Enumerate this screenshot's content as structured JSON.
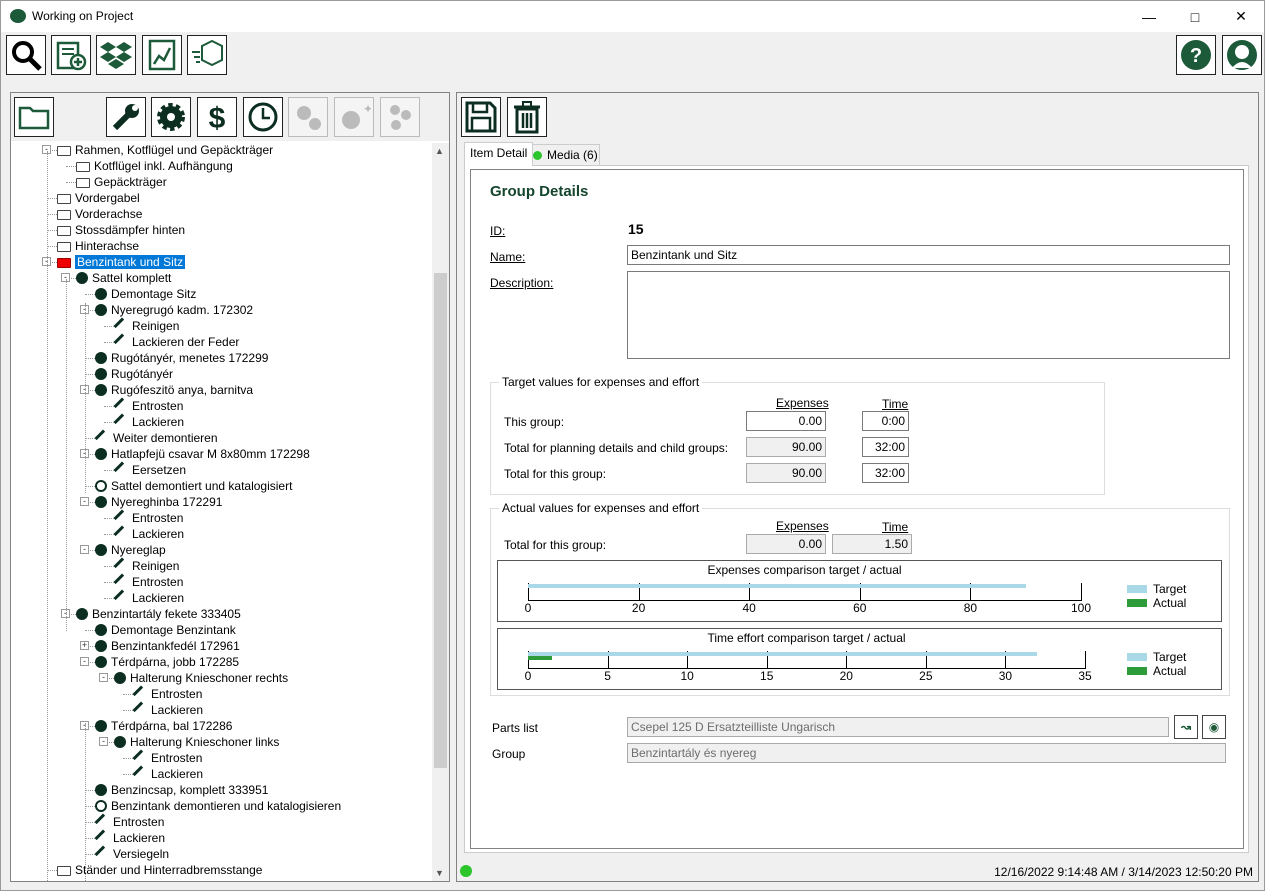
{
  "window": {
    "title": "Working on Project"
  },
  "toolbar": {
    "icons": [
      "search-icon",
      "new-document-icon",
      "dropbox-icon",
      "report-chart-icon",
      "package-icon",
      "help-icon",
      "support-icon"
    ]
  },
  "left_toolbar": {
    "icons": [
      "folder-icon",
      "wrench-icon",
      "gear-icon",
      "dollar-icon",
      "clock-icon",
      "gears-disabled-icon",
      "sparkle-gear-disabled-icon",
      "multi-gear-disabled-icon"
    ]
  },
  "tree": [
    {
      "label": "Rahmen, Kotflügel und Gepäckträger",
      "type": "folder"
    },
    {
      "label": "Kotflügel inkl. Aufhängung",
      "type": "folder"
    },
    {
      "label": "Gepäckträger",
      "type": "folder"
    },
    {
      "label": "Vordergabel",
      "type": "folder"
    },
    {
      "label": "Vorderachse",
      "type": "folder"
    },
    {
      "label": "Stossdämpfer hinten",
      "type": "folder"
    },
    {
      "label": "Hinterachse",
      "type": "folder"
    },
    {
      "label": "Benzintank und Sitz",
      "type": "folder-red",
      "selected": true
    },
    {
      "label": "Sattel komplett",
      "type": "gear"
    },
    {
      "label": "Demontage Sitz",
      "type": "gears"
    },
    {
      "label": "Nyeregrugó kadm. 172302",
      "type": "gear"
    },
    {
      "label": "Reinigen",
      "type": "wrench"
    },
    {
      "label": "Lackieren der Feder",
      "type": "wrench"
    },
    {
      "label": "Rugótányér, menetes 172299",
      "type": "gear"
    },
    {
      "label": "Rugótányér",
      "type": "gear"
    },
    {
      "label": "Rugófeszitö anya, barnitva",
      "type": "gear"
    },
    {
      "label": "Entrosten",
      "type": "wrench"
    },
    {
      "label": "Lackieren",
      "type": "wrench"
    },
    {
      "label": "Weiter demontieren",
      "type": "wrench"
    },
    {
      "label": "Hatlapfejü csavar M 8x80mm 172298",
      "type": "gear"
    },
    {
      "label": "Eersetzen",
      "type": "wrench"
    },
    {
      "label": "Sattel demontiert und katalogisiert",
      "type": "clock"
    },
    {
      "label": "Nyereghinba 172291",
      "type": "gear"
    },
    {
      "label": "Entrosten",
      "type": "wrench"
    },
    {
      "label": "Lackieren",
      "type": "wrench"
    },
    {
      "label": "Nyereglap",
      "type": "gear"
    },
    {
      "label": "Reinigen",
      "type": "wrench"
    },
    {
      "label": "Entrosten",
      "type": "wrench"
    },
    {
      "label": "Lackieren",
      "type": "wrench"
    },
    {
      "label": "Benzintartály fekete 333405",
      "type": "gear"
    },
    {
      "label": "Demontage Benzintank",
      "type": "gears"
    },
    {
      "label": "Benzintankfedél 172961",
      "type": "gear"
    },
    {
      "label": "Térdpárna, jobb 172285",
      "type": "gear"
    },
    {
      "label": "Halterung Knieschoner rechts",
      "type": "gear"
    },
    {
      "label": "Entrosten",
      "type": "wrench"
    },
    {
      "label": "Lackieren",
      "type": "wrench"
    },
    {
      "label": "Térdpárna, bal 172286",
      "type": "gear"
    },
    {
      "label": "Halterung Knieschoner links",
      "type": "gear"
    },
    {
      "label": "Entrosten",
      "type": "wrench"
    },
    {
      "label": "Lackieren",
      "type": "wrench"
    },
    {
      "label": "Benzincsap, komplett 333951",
      "type": "gear"
    },
    {
      "label": "Benzintank demontieren und katalogisieren",
      "type": "clock"
    },
    {
      "label": "Entrosten",
      "type": "wrench"
    },
    {
      "label": "Lackieren",
      "type": "wrench"
    },
    {
      "label": "Versiegeln",
      "type": "wrench"
    },
    {
      "label": "Ständer und Hinterradbremsstange",
      "type": "folder"
    }
  ],
  "right_toolbar": {
    "icons": [
      "save-icon",
      "delete-icon"
    ]
  },
  "tabs": [
    {
      "label": "Item Detail"
    },
    {
      "label": "Media (6)"
    }
  ],
  "details": {
    "heading": "Group Details",
    "id_label": "ID:",
    "id_value": "15",
    "name_label": "Name:",
    "name_value": "Benzintank und Sitz",
    "desc_label": "Description:",
    "desc_value": ""
  },
  "target": {
    "legend": "Target values for expenses and effort",
    "col_expenses": "Expenses",
    "col_time": "Time",
    "rows": [
      {
        "label": "This group:",
        "expenses": "0.00",
        "time": "0:00"
      },
      {
        "label": "Total for planning details and child groups:",
        "expenses": "90.00",
        "time": "32:00"
      },
      {
        "label": "Total for this group:",
        "expenses": "90.00",
        "time": "32:00"
      }
    ]
  },
  "actual": {
    "legend": "Actual values for expenses and effort",
    "col_expenses": "Expenses",
    "col_time": "Time",
    "row_label": "Total for this group:",
    "expenses": "0.00",
    "time": "1.50"
  },
  "chart_data": [
    {
      "type": "bar",
      "title": "Expenses comparison target / actual",
      "xlim": [
        0,
        100
      ],
      "ticks": [
        "0",
        "20",
        "40",
        "60",
        "80",
        "100"
      ],
      "series": [
        {
          "name": "Target",
          "values": [
            90
          ]
        },
        {
          "name": "Actual",
          "values": [
            0
          ]
        }
      ],
      "colors": {
        "Target": "#a9d9e6",
        "Actual": "#2e9b3a"
      }
    },
    {
      "type": "bar",
      "title": "Time effort comparison target / actual",
      "xlim": [
        0,
        35
      ],
      "ticks": [
        "0",
        "5",
        "10",
        "15",
        "20",
        "25",
        "30",
        "35"
      ],
      "series": [
        {
          "name": "Target",
          "values": [
            32
          ]
        },
        {
          "name": "Actual",
          "values": [
            1.5
          ]
        }
      ],
      "colors": {
        "Target": "#a9d9e6",
        "Actual": "#2e9b3a"
      }
    }
  ],
  "parts": {
    "parts_label": "Parts list",
    "parts_value": "Csepel 125 D Ersatzteilliste Ungarisch",
    "group_label": "Group",
    "group_value": "Benzintartály és nyereg"
  },
  "status": {
    "timestamps": "12/16/2022 9:14:48 AM / 3/14/2023 12:50:20 PM"
  }
}
